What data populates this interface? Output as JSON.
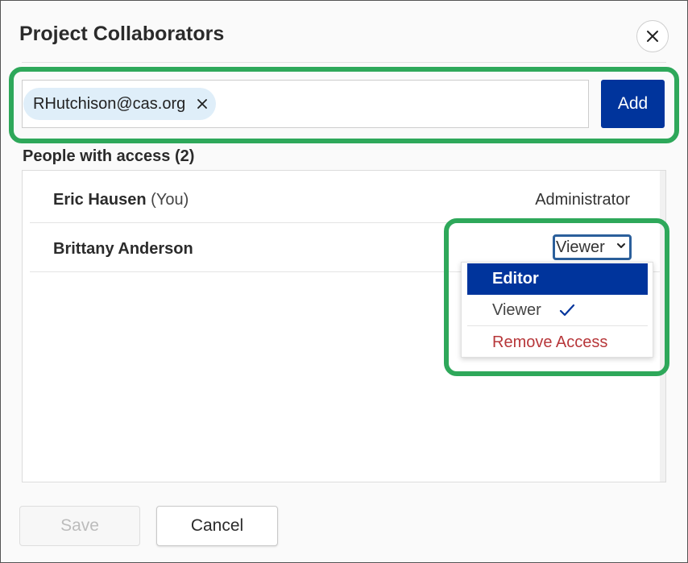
{
  "dialog": {
    "title": "Project Collaborators"
  },
  "invite": {
    "chip_email": "RHutchison@cas.org",
    "add_label": "Add"
  },
  "access": {
    "heading": "People with access (2)",
    "people": [
      {
        "name": "Eric Hausen",
        "you_tag": "(You)",
        "role": "Administrator"
      },
      {
        "name": "Brittany Anderson",
        "role": "Viewer"
      }
    ]
  },
  "role_menu": {
    "options": [
      {
        "label": "Editor",
        "state": "highlighted"
      },
      {
        "label": "Viewer",
        "state": "selected"
      },
      {
        "label": "Remove Access",
        "state": "destructive"
      }
    ]
  },
  "footer": {
    "save_label": "Save",
    "cancel_label": "Cancel"
  },
  "colors": {
    "primary": "#00349c",
    "highlight_outline": "#2ea85a",
    "chip_bg": "#dfeef9",
    "danger": "#b7373a",
    "focus_border": "#2b5f9b"
  },
  "icons": {
    "close": "close-icon",
    "chip_remove": "remove-chip-icon",
    "select_caret": "chevron-down-icon",
    "selected_mark": "checkmark-icon"
  }
}
